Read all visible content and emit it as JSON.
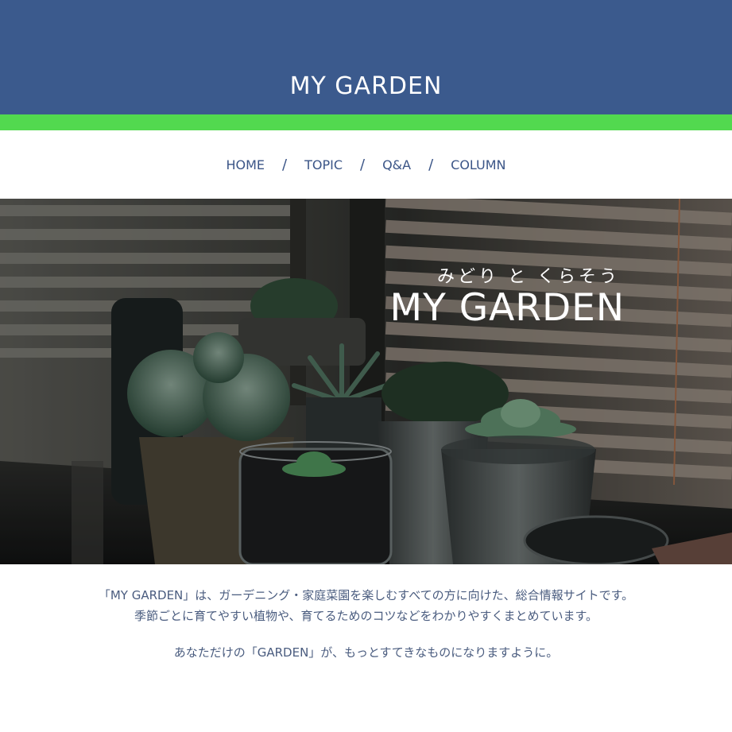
{
  "header": {
    "title": "MY GARDEN",
    "bg_color": "#3b5a8d",
    "accent_color": "#52d94f"
  },
  "nav": {
    "items": [
      {
        "label": "HOME"
      },
      {
        "label": "TOPIC"
      },
      {
        "label": "Q&A"
      },
      {
        "label": "COLUMN"
      }
    ],
    "separator": "/"
  },
  "hero": {
    "subtitle": "みどり と くらそう",
    "title": "MY GARDEN"
  },
  "intro": {
    "line1": "「MY GARDEN」は、ガーデニング・家庭菜園を楽しむすべての方に向けた、総合情報サイトです。",
    "line2": "季節ごとに育てやすい植物や、育てるためのコツなどをわかりやすくまとめています。",
    "line3": "あなただけの「GARDEN」が、もっとすてきなものになりますように。"
  }
}
